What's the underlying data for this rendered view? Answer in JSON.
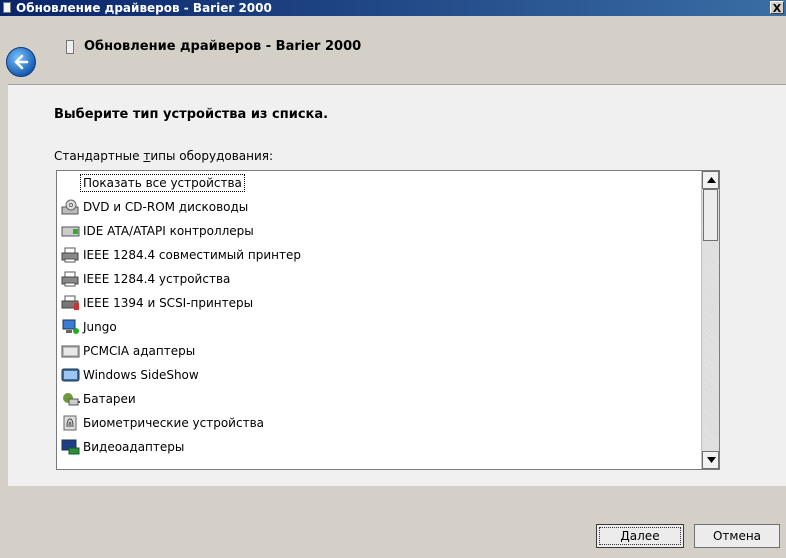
{
  "window": {
    "title": "Обновление драйверов - Barier 2000",
    "close_label": "X"
  },
  "header": {
    "title": "Обновление драйверов - Barier 2000"
  },
  "content": {
    "instruction": "Выберите тип устройства из списка.",
    "list_label_prefix": "Стандартные ",
    "list_label_accel": "т",
    "list_label_suffix": "ипы оборудования:",
    "items": [
      {
        "label": "Показать все устройства",
        "icon": "none-icon",
        "selected": true
      },
      {
        "label": "DVD и CD-ROM дисководы",
        "icon": "dvd-drive-icon"
      },
      {
        "label": "IDE ATA/ATAPI контроллеры",
        "icon": "ide-controller-icon"
      },
      {
        "label": "IEEE 1284.4 совместимый принтер",
        "icon": "printer-icon"
      },
      {
        "label": "IEEE 1284.4 устройства",
        "icon": "printer-icon"
      },
      {
        "label": "IEEE 1394 и SCSI-принтеры",
        "icon": "scsi-printer-icon"
      },
      {
        "label": "Jungo",
        "icon": "network-device-icon"
      },
      {
        "label": "PCMCIA адаптеры",
        "icon": "pcmcia-adapter-icon"
      },
      {
        "label": "Windows SideShow",
        "icon": "sideshow-icon"
      },
      {
        "label": "Батареи",
        "icon": "battery-icon"
      },
      {
        "label": "Биометрические устройства",
        "icon": "fingerprint-icon"
      },
      {
        "label": "Видеоадаптеры",
        "icon": "display-adapter-icon"
      }
    ]
  },
  "footer": {
    "next_accel": "Д",
    "next_rest": "алее",
    "cancel_label": "Отмена"
  },
  "colors": {
    "titlebar_start": "#0a246a",
    "titlebar_end": "#3a6ea5",
    "accent_blue": "#1a5fb4"
  }
}
